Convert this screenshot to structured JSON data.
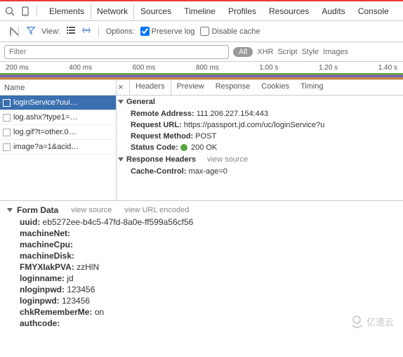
{
  "panels": [
    "Elements",
    "Network",
    "Sources",
    "Timeline",
    "Profiles",
    "Resources",
    "Audits",
    "Console"
  ],
  "active_panel": "Network",
  "controls": {
    "view_label": "View:",
    "options_label": "Options:",
    "preserve_log": {
      "label": "Preserve log",
      "checked": true
    },
    "disable_cache": {
      "label": "Disable cache",
      "checked": false
    }
  },
  "filter": {
    "placeholder": "Filter",
    "types": [
      "All",
      "XHR",
      "Script",
      "Style",
      "Images"
    ]
  },
  "timeline": {
    "ticks": [
      "200 ms",
      "400 ms",
      "600 ms",
      "800 ms",
      "1.00 s",
      "1.20 s",
      "1.40 s"
    ]
  },
  "requests": {
    "header": "Name",
    "items": [
      {
        "label": "loginService?uui…",
        "selected": true
      },
      {
        "label": "log.ashx?type1=…",
        "selected": false
      },
      {
        "label": "log.gif?t=other.0…",
        "selected": false
      },
      {
        "label": "image?a=1&acid…",
        "selected": false
      }
    ]
  },
  "detail_tabs": [
    "Headers",
    "Preview",
    "Response",
    "Cookies",
    "Timing"
  ],
  "general": {
    "title": "General",
    "remote_address": {
      "k": "Remote Address:",
      "v": "111.206.227.154:443"
    },
    "request_url": {
      "k": "Request URL:",
      "v": "https://passport.jd.com/uc/loginService?u"
    },
    "request_method": {
      "k": "Request Method:",
      "v": "POST"
    },
    "status_code": {
      "k": "Status Code:",
      "v": "200 OK"
    }
  },
  "response_headers": {
    "title": "Response Headers",
    "view_source": "view source",
    "cache_control": {
      "k": "Cache-Control:",
      "v": "max-age=0"
    }
  },
  "form_data": {
    "title": "Form Data",
    "view_source": "view source",
    "view_url_encoded": "view URL encoded",
    "rows": [
      {
        "k": "uuid:",
        "v": "eb5272ee-b4c5-47fd-8a0e-ff599a56cf56"
      },
      {
        "k": "machineNet:",
        "v": ""
      },
      {
        "k": "machineCpu:",
        "v": ""
      },
      {
        "k": "machineDisk:",
        "v": ""
      },
      {
        "k": "FMYXIakPVA:",
        "v": "zzHlN"
      },
      {
        "k": "loginname:",
        "v": "jd"
      },
      {
        "k": "nloginpwd:",
        "v": "123456"
      },
      {
        "k": "loginpwd:",
        "v": "123456"
      },
      {
        "k": "chkRememberMe:",
        "v": "on"
      },
      {
        "k": "authcode:",
        "v": ""
      }
    ]
  },
  "watermark": "亿速云"
}
